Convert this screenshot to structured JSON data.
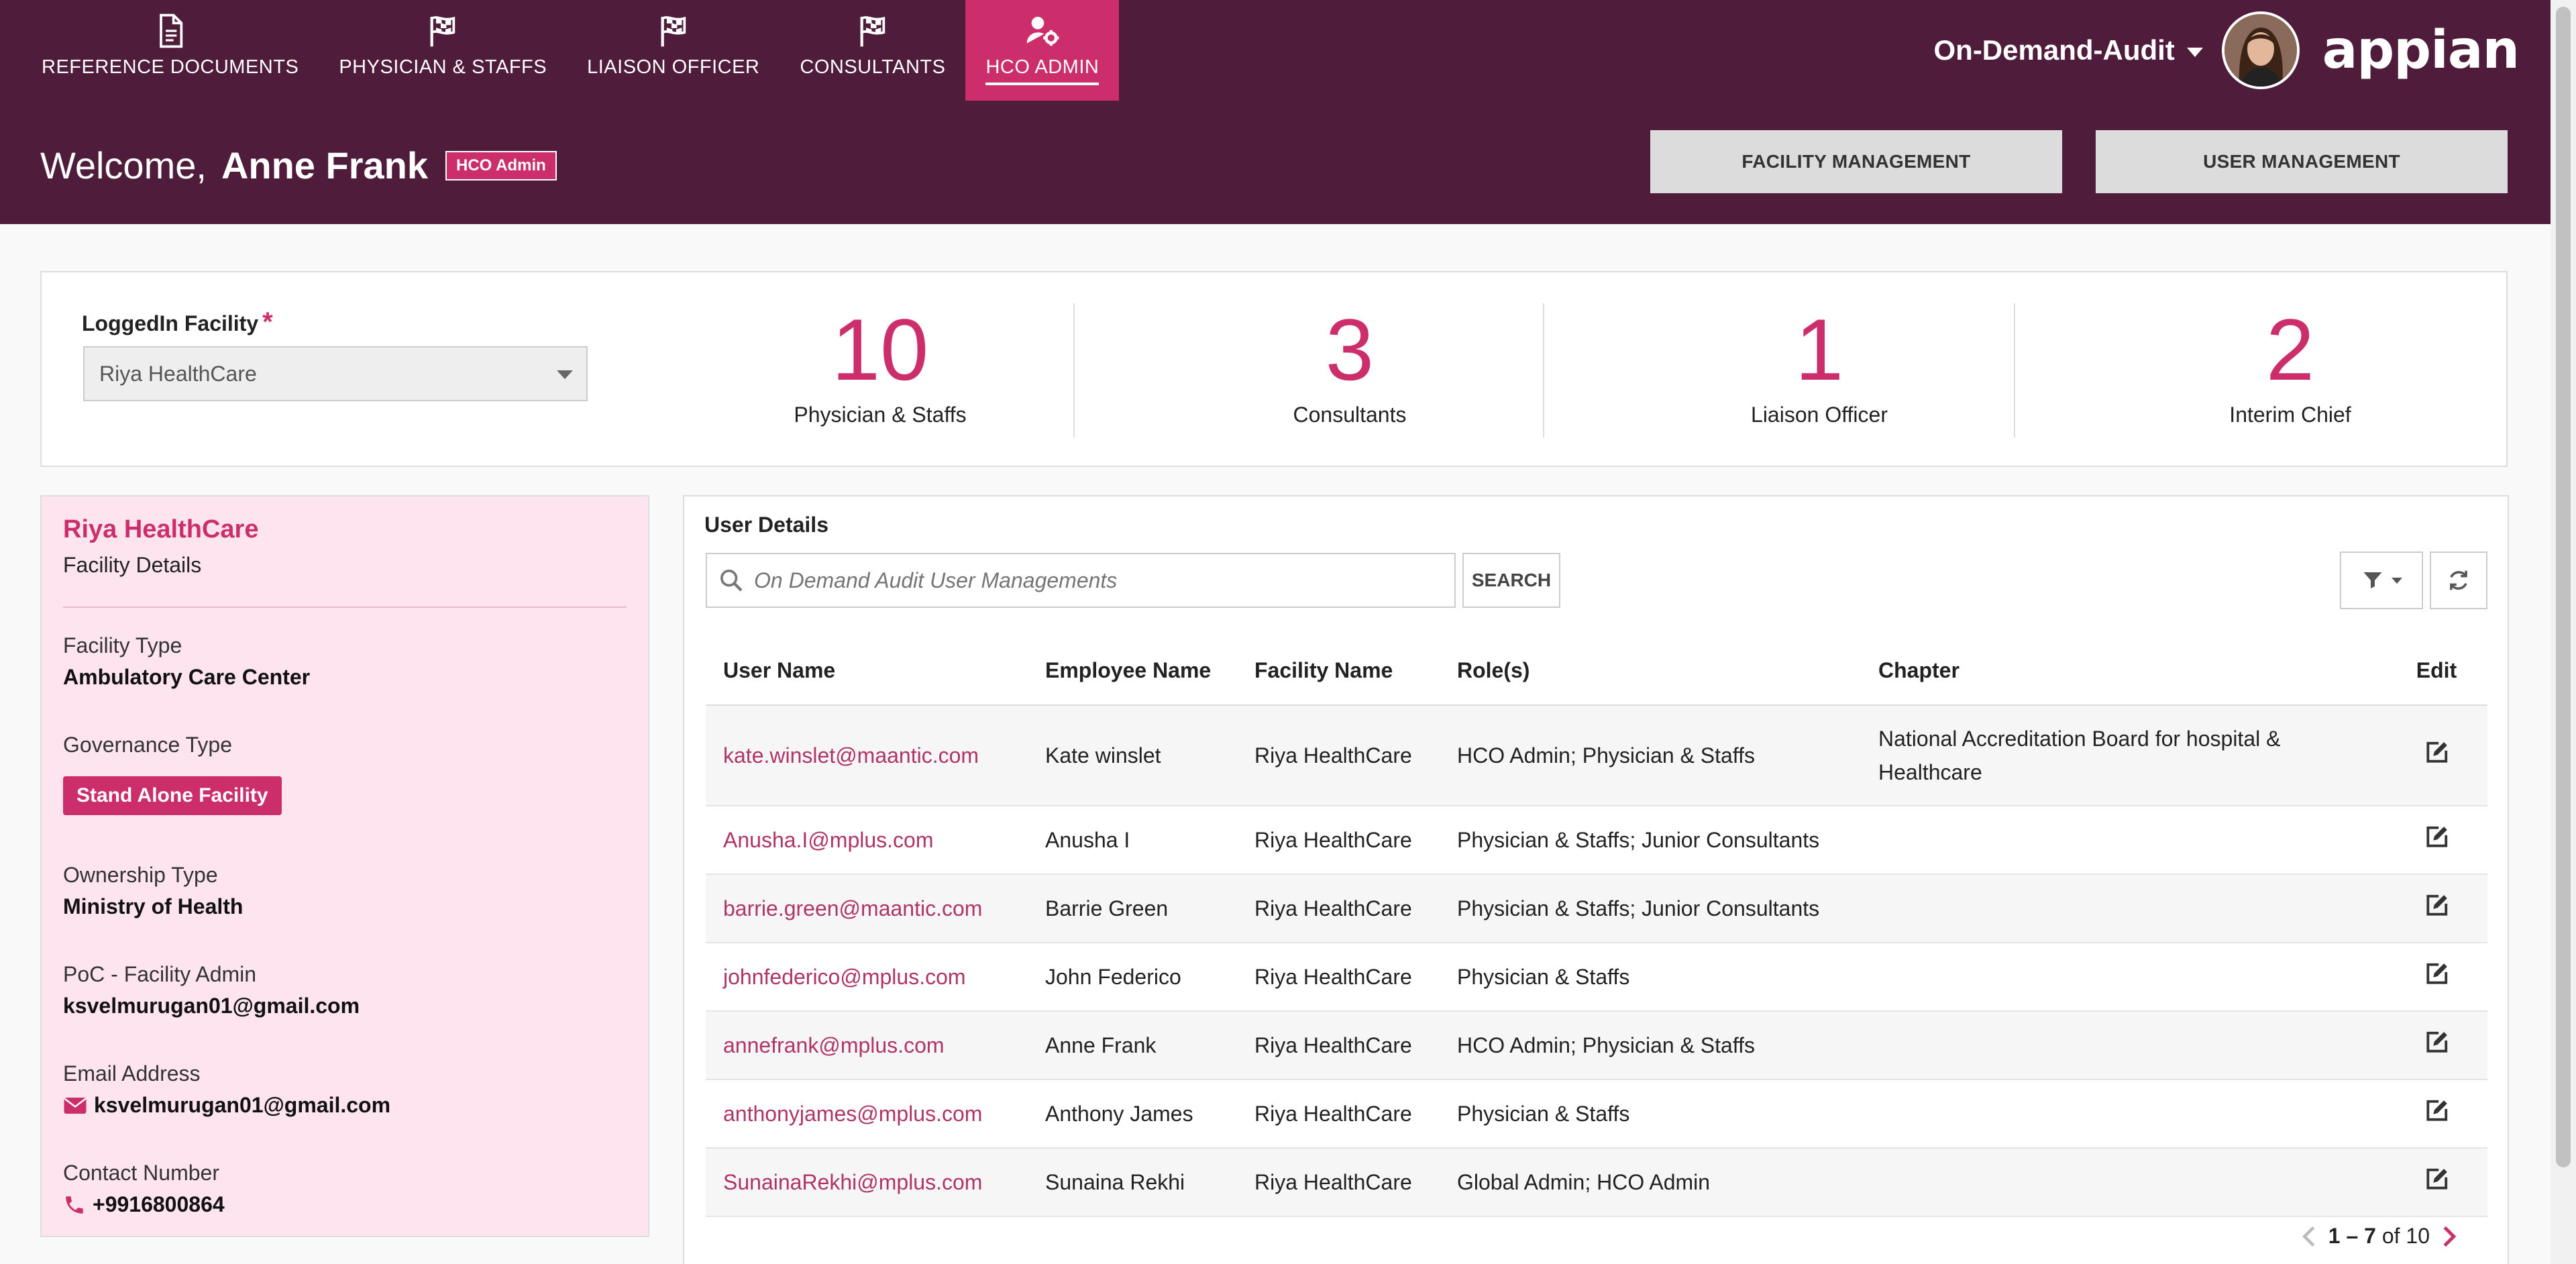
{
  "nav": {
    "tabs": [
      {
        "label": "REFERENCE DOCUMENTS",
        "icon": "document-icon"
      },
      {
        "label": "PHYSICIAN & STAFFS",
        "icon": "checkered-flag-icon"
      },
      {
        "label": "LIAISON OFFICER",
        "icon": "checkered-flag-icon"
      },
      {
        "label": "CONSULTANTS",
        "icon": "checkered-flag-icon"
      },
      {
        "label": "HCO ADMIN",
        "icon": "user-settings-icon",
        "active": true
      }
    ]
  },
  "account": {
    "site_name": "On-Demand-Audit",
    "brand": "appian"
  },
  "welcome": {
    "greeting": "Welcome,",
    "name": "Anne Frank",
    "role_badge": "HCO Admin"
  },
  "header_buttons": {
    "facility_management": "FACILITY MANAGEMENT",
    "user_management": "USER MANAGEMENT"
  },
  "summary": {
    "facility_label": "LoggedIn Facility",
    "required_mark": "*",
    "facility_selected": "Riya HealthCare",
    "stats": [
      {
        "value": "10",
        "label": "Physician & Staffs"
      },
      {
        "value": "3",
        "label": "Consultants"
      },
      {
        "value": "1",
        "label": "Liaison Officer"
      },
      {
        "value": "2",
        "label": "Interim Chief"
      }
    ]
  },
  "facility": {
    "name": "Riya HealthCare",
    "subtitle": "Facility Details",
    "type_label": "Facility Type",
    "type_value": "Ambulatory Care Center",
    "governance_label": "Governance Type",
    "governance_value": "Stand Alone Facility",
    "ownership_label": "Ownership Type",
    "ownership_value": "Ministry of Health",
    "poc_label": "PoC - Facility Admin",
    "poc_value": "ksvelmurugan01@gmail.com",
    "email_label": "Email Address",
    "email_value": "ksvelmurugan01@gmail.com",
    "contact_label": "Contact Number",
    "contact_value": "+9916800864"
  },
  "users": {
    "title": "User Details",
    "search_placeholder": "On Demand Audit User Managements",
    "search_button": "SEARCH",
    "columns": [
      "User Name",
      "Employee Name",
      "Facility Name",
      "Role(s)",
      "Chapter",
      "Edit"
    ],
    "rows": [
      {
        "user": "kate.winslet@maantic.com",
        "employee": "Kate winslet",
        "facility": "Riya HealthCare",
        "roles": "HCO Admin; Physician & Staffs",
        "chapter": "National Accreditation Board for hospital & Healthcare"
      },
      {
        "user": "Anusha.I@mplus.com",
        "employee": "Anusha I",
        "facility": "Riya HealthCare",
        "roles": "Physician & Staffs; Junior Consultants",
        "chapter": ""
      },
      {
        "user": "barrie.green@maantic.com",
        "employee": "Barrie Green",
        "facility": "Riya HealthCare",
        "roles": "Physician & Staffs; Junior Consultants",
        "chapter": ""
      },
      {
        "user": "johnfederico@mplus.com",
        "employee": "John Federico",
        "facility": "Riya HealthCare",
        "roles": "Physician & Staffs",
        "chapter": ""
      },
      {
        "user": "annefrank@mplus.com",
        "employee": "Anne Frank",
        "facility": "Riya HealthCare",
        "roles": "HCO Admin; Physician & Staffs",
        "chapter": ""
      },
      {
        "user": "anthonyjames@mplus.com",
        "employee": "Anthony James",
        "facility": "Riya HealthCare",
        "roles": "Physician & Staffs",
        "chapter": ""
      },
      {
        "user": "SunainaRekhi@mplus.com",
        "employee": "Sunaina Rekhi",
        "facility": "Riya HealthCare",
        "roles": "Global Admin; HCO Admin",
        "chapter": ""
      }
    ],
    "pager": {
      "range": "1 – 7",
      "of_text": "of 10"
    }
  },
  "colors": {
    "header": "#4f1c3b",
    "accent": "#cc2e6b",
    "panel_pink": "#fde4ef"
  }
}
